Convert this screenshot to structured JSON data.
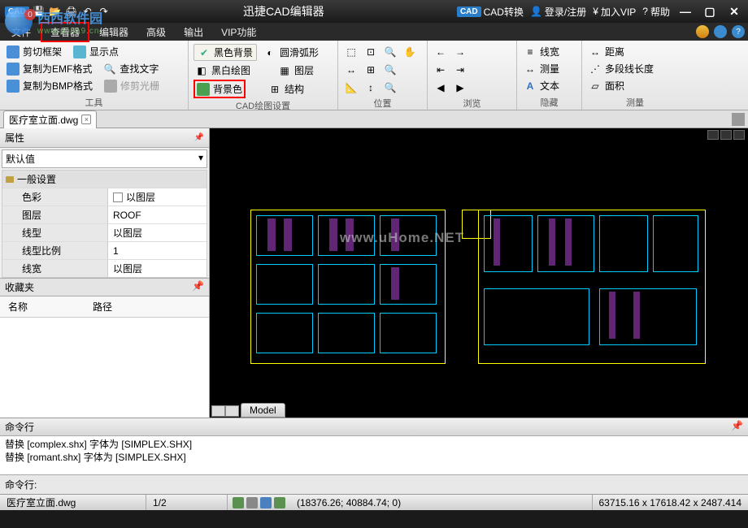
{
  "titlebar": {
    "app_title": "迅捷CAD编辑器",
    "cad_convert": "CAD转换",
    "login": "登录/注册",
    "vip": "加入VIP",
    "help": "帮助"
  },
  "menu": {
    "items": [
      "文件",
      "查看器",
      "编辑器",
      "高级",
      "输出",
      "VIP功能"
    ]
  },
  "ribbon": {
    "group_tools": {
      "label": "工具",
      "clip_frame": "剪切框架",
      "show_point": "显示点",
      "copy_emf": "复制为EMF格式",
      "find_text": "查找文字",
      "copy_bmp": "复制为BMP格式",
      "trim_light": "修剪光栅"
    },
    "group_cad": {
      "label": "CAD绘图设置",
      "black_bg": "黑色背景",
      "smooth_arc": "圆滑弧形",
      "bw_draw": "黑白绘图",
      "layer": "图层",
      "bg_color": "背景色",
      "structure": "结构"
    },
    "group_pos": {
      "label": "位置"
    },
    "group_browse": {
      "label": "浏览"
    },
    "group_hide": {
      "label": "隐藏",
      "linewidth": "线宽",
      "measure": "测量",
      "text": "文本"
    },
    "group_measure": {
      "label": "测量",
      "distance": "距离",
      "multiline": "多段线长度",
      "area": "面积"
    }
  },
  "file_tab": "医疗室立面.dwg",
  "props": {
    "title": "属性",
    "default": "默认值",
    "section": "一般设置",
    "rows": [
      {
        "name": "色彩",
        "value": "以图层",
        "swatch": true
      },
      {
        "name": "图层",
        "value": "ROOF"
      },
      {
        "name": "线型",
        "value": "以图层"
      },
      {
        "name": "线型比例",
        "value": "1"
      },
      {
        "name": "线宽",
        "value": "以图层"
      }
    ]
  },
  "fav": {
    "title": "收藏夹",
    "col_name": "名称",
    "col_path": "路径"
  },
  "model_tab": "Model",
  "cmd": {
    "title": "命令行",
    "lines": [
      "替换 [complex.shx] 字体为 [SIMPLEX.SHX]",
      "替换 [romant.shx] 字体为 [SIMPLEX.SHX]"
    ],
    "prompt": "命令行:"
  },
  "status": {
    "file": "医疗室立面.dwg",
    "page": "1/2",
    "coords1": "(18376.26; 40884.74; 0)",
    "coords2": "63715.16 x 17618.42 x 2487.414"
  },
  "wm_site_cn": "西西软件园",
  "wm_site_en": "www.pc6a9.cn",
  "wm_canvas": "www.uHome.NET"
}
